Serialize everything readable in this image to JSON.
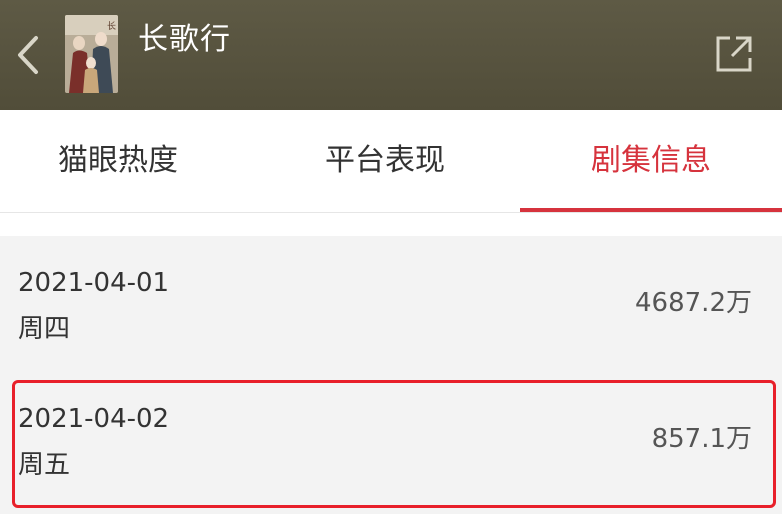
{
  "header": {
    "title": "长歌行",
    "back_icon": "chevron-left-icon",
    "share_icon": "share-external-icon",
    "poster_alt": ""
  },
  "tabs": [
    {
      "label": "猫眼热度",
      "active": false
    },
    {
      "label": "平台表现",
      "active": false
    },
    {
      "label": "剧集信息",
      "active": true
    }
  ],
  "colors": {
    "header_bg": "#56523e",
    "accent": "#d6333d",
    "highlight": "#e8202a",
    "list_bg": "#f3f3f3"
  },
  "list": [
    {
      "date": "2021-04-01",
      "weekday": "周四",
      "value": "4687.2万"
    },
    {
      "date": "2021-04-02",
      "weekday": "周五",
      "value": "857.1万",
      "highlighted": true
    }
  ]
}
